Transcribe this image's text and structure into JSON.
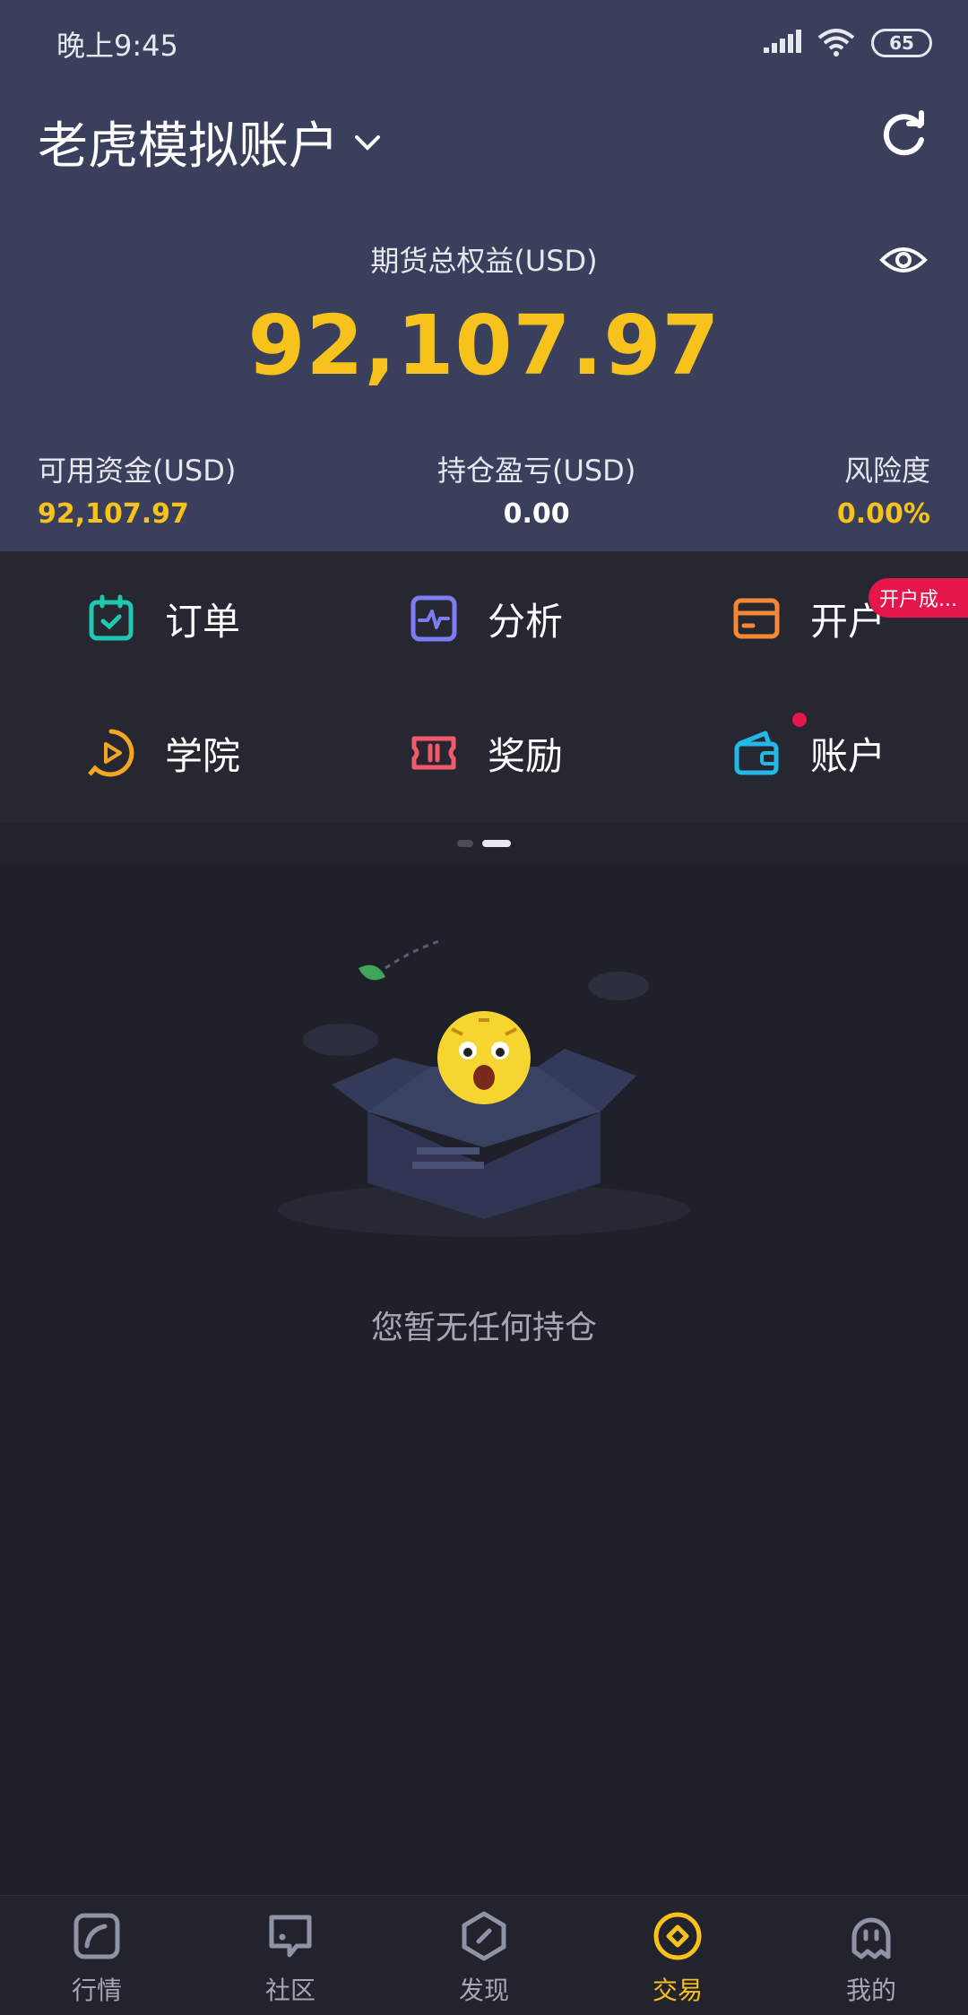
{
  "status_bar": {
    "time": "晚上9:45",
    "battery": "65"
  },
  "account": {
    "title": "老虎模拟账户"
  },
  "equity": {
    "label": "期货总权益(USD)",
    "value": "92,107.97"
  },
  "metrics": [
    {
      "label": "可用资金(USD)",
      "value": "92,107.97",
      "color": "#f6c21b"
    },
    {
      "label": "持仓盈亏(USD)",
      "value": "0.00",
      "color": "#ffffff"
    },
    {
      "label": "风险度",
      "value": "0.00%",
      "color": "#f6c21b"
    }
  ],
  "menu": {
    "order": "订单",
    "analysis": "分析",
    "open_account": "开户",
    "open_badge": "开户成...",
    "academy": "学院",
    "reward": "奖励",
    "account": "账户"
  },
  "empty_state": {
    "text": "您暂无任何持仓"
  },
  "nav": [
    {
      "label": "行情",
      "icon": "market-icon"
    },
    {
      "label": "社区",
      "icon": "community-icon"
    },
    {
      "label": "发现",
      "icon": "discover-icon"
    },
    {
      "label": "交易",
      "icon": "trade-icon",
      "active": true
    },
    {
      "label": "我的",
      "icon": "profile-icon"
    }
  ],
  "colors": {
    "header_bg": "#3a3f5c",
    "accent": "#f6c21b",
    "badge": "#e5164a",
    "page_bg": "#1f2029"
  }
}
